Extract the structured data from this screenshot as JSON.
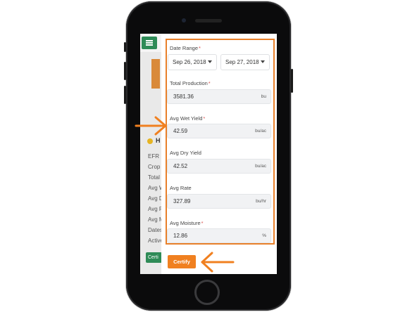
{
  "form": {
    "date_range": {
      "label": "Date Range",
      "required_mark": "*",
      "start": "Sep 26, 2018",
      "end": "Sep 27, 2018"
    },
    "fields": [
      {
        "label": "Total Production",
        "required_mark": "*",
        "value": "3581.36",
        "unit": "bu"
      },
      {
        "label": "Avg Wet Yield",
        "required_mark": "*",
        "value": "42.59",
        "unit": "bu/ac"
      },
      {
        "label": "Avg Dry Yield",
        "required_mark": "",
        "value": "42.52",
        "unit": "bu/ac"
      },
      {
        "label": "Avg Rate",
        "required_mark": "",
        "value": "327.89",
        "unit": "bu/hr"
      },
      {
        "label": "Avg Moisture",
        "required_mark": "*",
        "value": "12.86",
        "unit": "%"
      }
    ],
    "certify_label": "Certify"
  },
  "background_page": {
    "heading_letter": "H",
    "rows": [
      "EFR ID",
      "Crop",
      "Total",
      "Avg W",
      "Avg D",
      "Avg R",
      "Avg M",
      "Dates",
      "Active"
    ],
    "button_label": "Certi"
  },
  "colors": {
    "accent": "#f08020",
    "highlight_border": "#e8802a",
    "brand_green": "#2e8b57",
    "required": "#d9534f"
  },
  "icons": [
    "hamburger-menu-icon",
    "chevron-down-icon",
    "arrow-right-annotation-icon",
    "arrow-left-annotation-icon",
    "smiley-icon"
  ]
}
